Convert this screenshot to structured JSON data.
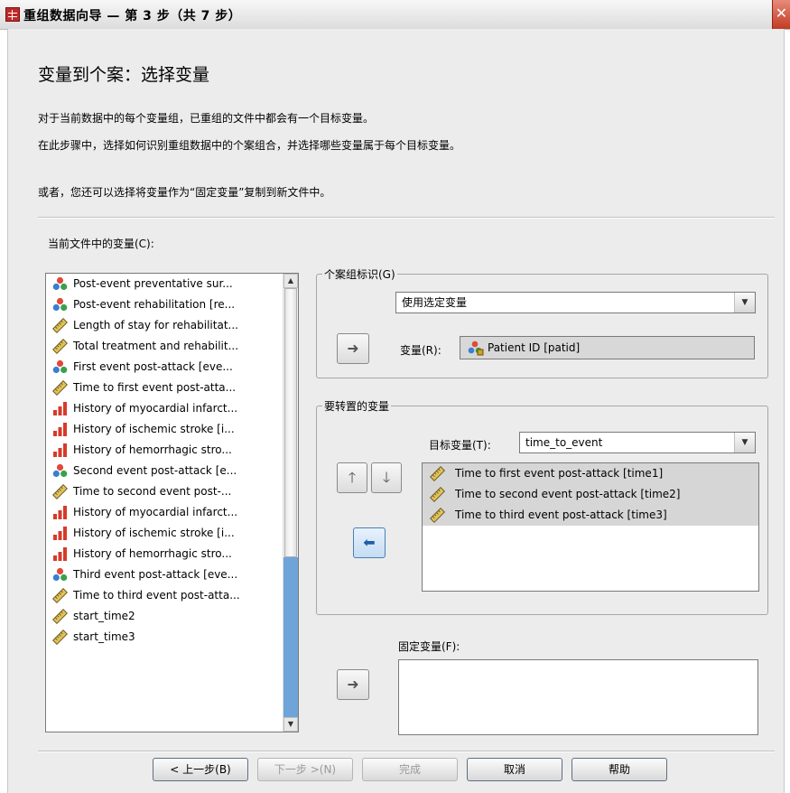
{
  "window": {
    "title": "重组数据向导 — 第 3 步（共 7 步）",
    "close_glyph": "✕"
  },
  "header": {
    "heading": "变量到个案：选择变量",
    "line1": "对于当前数据中的每个变量组，已重组的文件中都会有一个目标变量。",
    "line2": "在此步骤中，选择如何识别重组数据中的个案组合，并选择哪些变量属于每个目标变量。",
    "line3": "或者，您还可以选择将变量作为“固定变量”复制到新文件中。"
  },
  "current_vars": {
    "label": "当前文件中的变量(C):",
    "items": [
      {
        "icon": "nominal-icon",
        "label": "Post-event preventative sur..."
      },
      {
        "icon": "nominal-icon",
        "label": "Post-event rehabilitation [re..."
      },
      {
        "icon": "scale-ruler-icon",
        "label": "Length of stay for rehabilitat..."
      },
      {
        "icon": "scale-ruler-icon",
        "label": "Total treatment and rehabilit..."
      },
      {
        "icon": "nominal-icon",
        "label": "First event post-attack [eve..."
      },
      {
        "icon": "scale-ruler-icon",
        "label": "Time to first event post-atta..."
      },
      {
        "icon": "ordinal-bars-icon",
        "label": "History of myocardial infarct..."
      },
      {
        "icon": "ordinal-bars-icon",
        "label": "History of ischemic stroke [i..."
      },
      {
        "icon": "ordinal-bars-icon",
        "label": "History of hemorrhagic stro..."
      },
      {
        "icon": "nominal-icon",
        "label": "Second event post-attack [e..."
      },
      {
        "icon": "scale-ruler-icon",
        "label": "Time to second event post-..."
      },
      {
        "icon": "ordinal-bars-icon",
        "label": "History of myocardial infarct..."
      },
      {
        "icon": "ordinal-bars-icon",
        "label": "History of ischemic stroke [i..."
      },
      {
        "icon": "ordinal-bars-icon",
        "label": "History of hemorrhagic stro..."
      },
      {
        "icon": "nominal-icon",
        "label": "Third event post-attack [eve..."
      },
      {
        "icon": "scale-ruler-icon",
        "label": "Time to third event post-atta..."
      },
      {
        "icon": "scale-ruler-icon",
        "label": "start_time2"
      },
      {
        "icon": "scale-ruler-icon",
        "label": "start_time3"
      }
    ]
  },
  "case_group": {
    "legend": "个案组标识(G)",
    "method_value": "使用选定变量",
    "var_label": "变量(R):",
    "var_value": "Patient ID [patid]"
  },
  "transpose": {
    "legend": "要转置的变量",
    "target_label": "目标变量(T):",
    "target_value": "time_to_event",
    "items": [
      "Time to first event post-attack [time1]",
      "Time to second event post-attack [time2]",
      "Time to third event post-attack [time3]"
    ]
  },
  "fixed": {
    "label": "固定变量(F):"
  },
  "buttons": {
    "back": "< 上一步(B)",
    "next": "下一步 >(N)",
    "finish": "完成",
    "cancel": "取消",
    "help": "帮助"
  },
  "colors": {
    "dialog_bg": "#ececec",
    "scroll_track": "#6fa4d8",
    "active_arrow": "#1e5fa8",
    "close_btn": "#c23b22"
  }
}
